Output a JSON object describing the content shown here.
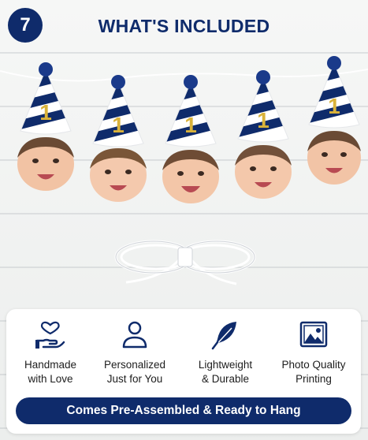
{
  "step": {
    "number": "7"
  },
  "header": {
    "title": "WHAT'S INCLUDED"
  },
  "garland": {
    "items": [
      {
        "name": "baby-face-hat-1",
        "hat_number": "1"
      },
      {
        "name": "baby-face-hat-2",
        "hat_number": "1"
      },
      {
        "name": "baby-face-hat-3",
        "hat_number": "1"
      },
      {
        "name": "baby-face-hat-4",
        "hat_number": "1"
      },
      {
        "name": "baby-face-hat-5",
        "hat_number": "1"
      }
    ]
  },
  "features": [
    {
      "icon": "hand-heart-icon",
      "label": "Handmade\nwith Love"
    },
    {
      "icon": "person-icon",
      "label": "Personalized\nJust for You"
    },
    {
      "icon": "feather-icon",
      "label": "Lightweight\n& Durable"
    },
    {
      "icon": "image-icon",
      "label": "Photo Quality\nPrinting"
    }
  ],
  "banner": {
    "text": "Comes Pre-Assembled & Ready to Hang"
  },
  "colors": {
    "navy": "#0f2b6b",
    "gold": "#d9b23a",
    "white": "#ffffff"
  }
}
